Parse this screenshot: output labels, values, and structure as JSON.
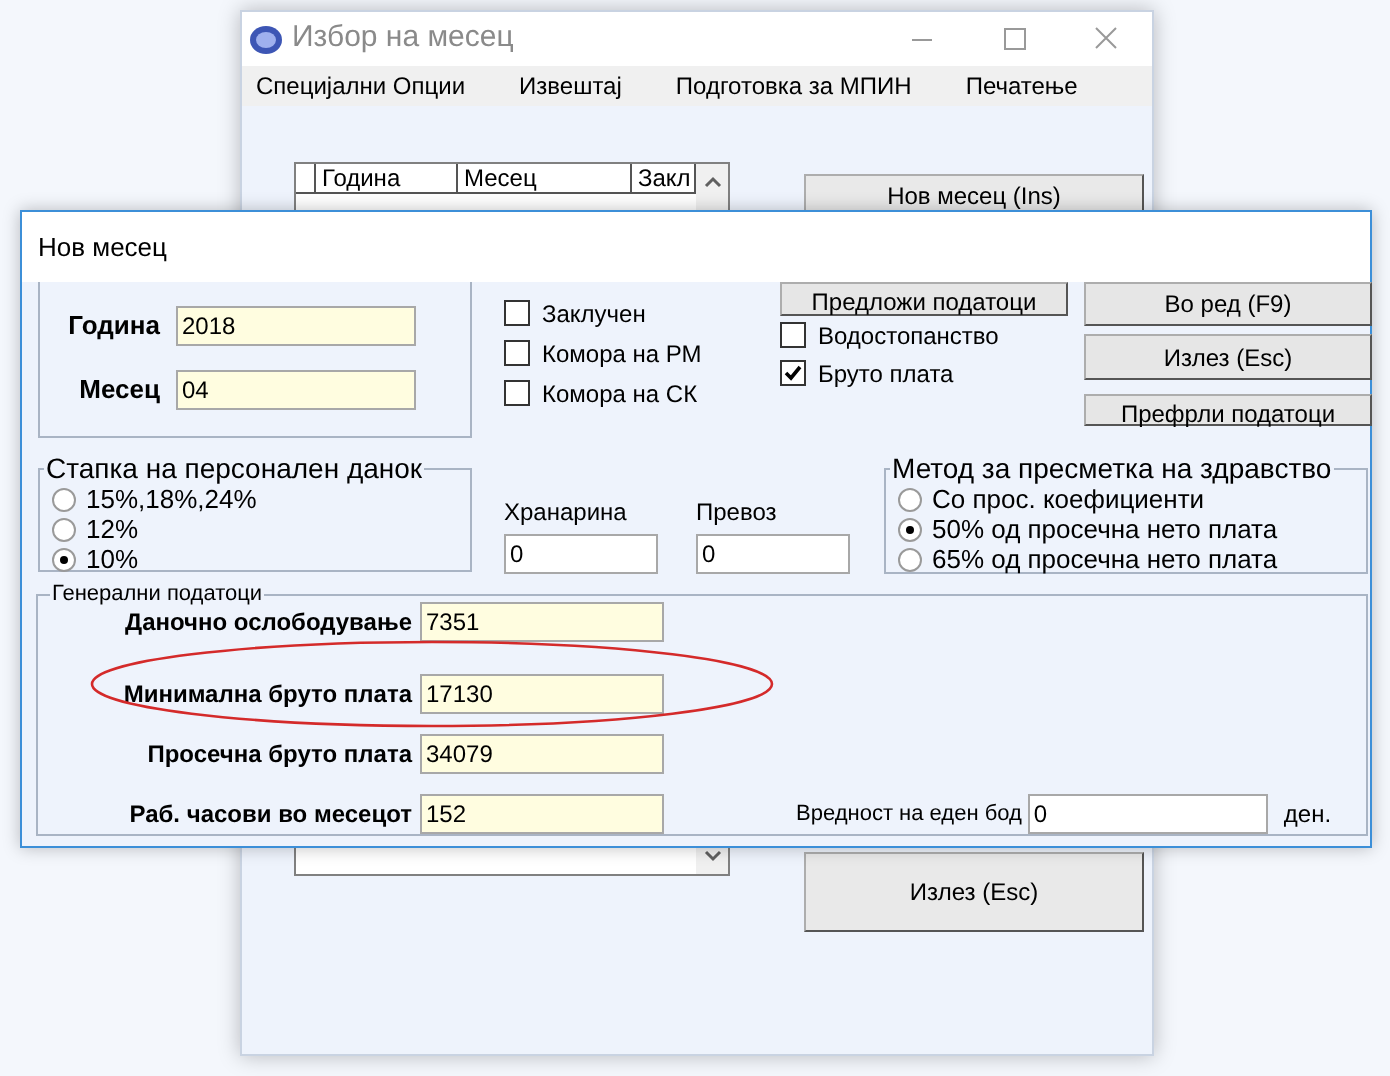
{
  "main_window": {
    "title": "Избор на месец",
    "menu": [
      "Специјални Опции",
      "Извештај",
      "Подготовка за МПИН",
      "Печатење"
    ],
    "table": {
      "columns": [
        "Година",
        "Месец",
        "Закл"
      ]
    },
    "buttons": [
      "Нов месец (Ins)",
      "Излез (Esc)"
    ]
  },
  "dialog": {
    "title": "Нов месец",
    "period_fields": [
      {
        "label": "Година",
        "value": "2018"
      },
      {
        "label": "Месец",
        "value": "04"
      }
    ],
    "checkboxes": [
      {
        "label": "Заклучен",
        "checked": false
      },
      {
        "label": "Комора на РМ",
        "checked": false
      },
      {
        "label": "Комора на СК",
        "checked": false
      }
    ],
    "suggest_button": "Предложи податоци",
    "options": [
      {
        "label": "Водостопанство",
        "checked": false
      },
      {
        "label": "Бруто плата",
        "checked": true
      }
    ],
    "action_buttons": [
      "Во ред (F9)",
      "Излез (Esc)",
      "Префрли податоци"
    ],
    "tax_rate": {
      "title": "Стапка на персонален данок",
      "options": [
        {
          "label": "15%,18%,24%",
          "selected": false
        },
        {
          "label": "12%",
          "selected": false
        },
        {
          "label": "10%",
          "selected": true
        }
      ]
    },
    "allowances": [
      {
        "label": "Хранарина",
        "value": "0"
      },
      {
        "label": "Превоз",
        "value": "0"
      }
    ],
    "health_method": {
      "title": "Метод за пресметка на здравство",
      "options": [
        {
          "label": "Со прос. коефициенти",
          "selected": false
        },
        {
          "label": "50% од просечна нето плата",
          "selected": true
        },
        {
          "label": "65% од просечна нето плата",
          "selected": false
        }
      ]
    },
    "general": {
      "title": "Генерални податоци",
      "fields": [
        {
          "label": "Даночно ослободување",
          "value": "7351"
        },
        {
          "label": "Минимална бруто плата",
          "value": "17130"
        },
        {
          "label": "Просечна бруто плата",
          "value": "34079"
        },
        {
          "label": "Раб. часови во месецот",
          "value": "152"
        }
      ],
      "point_value": {
        "label": "Вредност на еден бод",
        "value": "0",
        "unit": "ден."
      }
    }
  }
}
